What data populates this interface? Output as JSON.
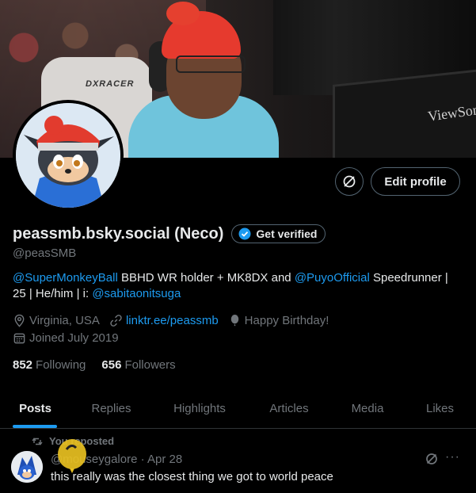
{
  "banner": {
    "chair_brand": "DXRACER",
    "monitor_brand": "ViewSoni"
  },
  "profile": {
    "display_name": "peassmb.bsky.social (Neco)",
    "handle": "@peasSMB",
    "get_verified_label": "Get verified",
    "edit_profile_label": "Edit profile",
    "bio": {
      "mention_1": "@SuperMonkeyBall",
      "text_1": " BBHD WR holder + MK8DX and ",
      "mention_2": "@PuyoOfficial",
      "text_2": " Speedrunner | 25 | He/him | i: ",
      "mention_3": "@sabitaonitsuga"
    },
    "location": "Virginia, USA",
    "website": "linktr.ee/peassmb",
    "birthday": "Happy Birthday!",
    "joined": "Joined July 2019",
    "following_count": "852",
    "following_label": "Following",
    "followers_count": "656",
    "followers_label": "Followers"
  },
  "tabs": [
    "Posts",
    "Replies",
    "Highlights",
    "Articles",
    "Media",
    "Likes"
  ],
  "active_tab": "Posts",
  "post": {
    "repost_label": "You reposted",
    "author": "@mouseygalore",
    "separator": " · ",
    "date": "Apr 28",
    "text": "this really was the closest thing we got to world peace",
    "more": "···"
  },
  "colors": {
    "accent": "#1d9bf0",
    "muted": "#71767b",
    "text": "#e7e9ea",
    "border": "#536471",
    "balloon": "#e8c021"
  },
  "icons": [
    "grok-icon",
    "verified-badge-icon",
    "location-icon",
    "link-icon",
    "balloon-icon",
    "calendar-icon",
    "repost-icon",
    "more-icon"
  ]
}
